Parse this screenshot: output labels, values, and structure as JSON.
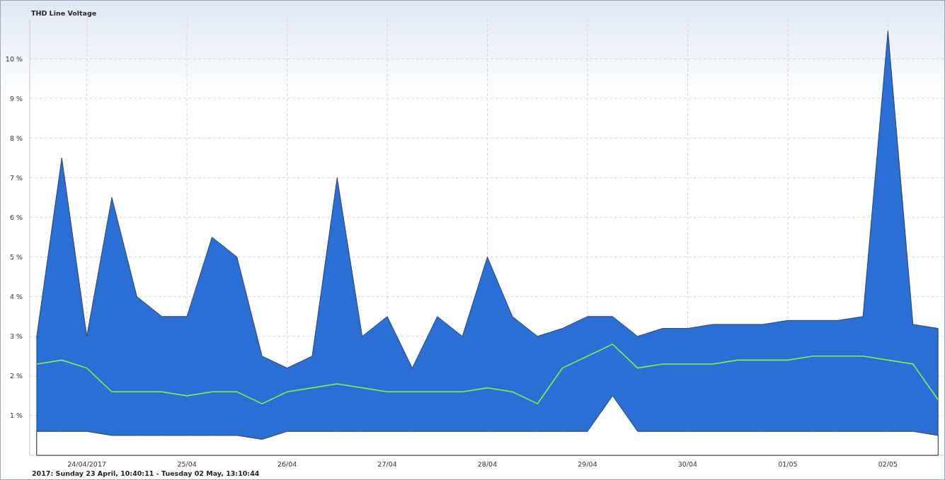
{
  "chart": {
    "title": "THD Line Voltage",
    "range_label": "2017: Sunday 23 April, 10:40:11 - Tuesday 02 May, 13:10:44",
    "chart_data": {
      "type": "area",
      "grid": true,
      "ylim": [
        0,
        11
      ],
      "yticks": [
        {
          "value": 1,
          "label": "1 %"
        },
        {
          "value": 2,
          "label": "2 %"
        },
        {
          "value": 3,
          "label": "3 %"
        },
        {
          "value": 4,
          "label": "4 %"
        },
        {
          "value": 5,
          "label": "5 %"
        },
        {
          "value": 6,
          "label": "6 %"
        },
        {
          "value": 7,
          "label": "7 %"
        },
        {
          "value": 8,
          "label": "8 %"
        },
        {
          "value": 9,
          "label": "9 %"
        },
        {
          "value": 10,
          "label": "10 %"
        }
      ],
      "categories": [
        null,
        null,
        "24/04/2017",
        null,
        null,
        null,
        "25/04",
        null,
        null,
        null,
        "26/04",
        null,
        null,
        null,
        "27/04",
        null,
        null,
        null,
        "28/04",
        null,
        null,
        null,
        "29/04",
        null,
        null,
        null,
        "30/04",
        null,
        null,
        null,
        "01/05",
        null,
        null,
        null,
        "02/05",
        null,
        null
      ],
      "series": [
        {
          "color": "#2a6fd6",
          "values": [
            3.0,
            7.5,
            3.0,
            6.5,
            4.0,
            3.5,
            3.5,
            5.5,
            5.0,
            2.5,
            2.2,
            2.5,
            7.0,
            3.0,
            3.5,
            2.2,
            3.5,
            3.0,
            5.0,
            3.5,
            3.0,
            3.2,
            3.5,
            3.5,
            3.0,
            3.2,
            3.2,
            3.3,
            3.3,
            3.3,
            3.4,
            3.4,
            3.4,
            3.5,
            10.7,
            3.3,
            3.2
          ]
        },
        {
          "color": "#ffffff",
          "values": [
            0.6,
            0.6,
            0.6,
            0.5,
            0.5,
            0.5,
            0.5,
            0.5,
            0.5,
            0.4,
            0.6,
            0.6,
            0.6,
            0.6,
            0.6,
            0.6,
            0.6,
            0.6,
            0.6,
            0.6,
            0.6,
            0.6,
            0.6,
            1.5,
            0.6,
            0.6,
            0.6,
            0.6,
            0.6,
            0.6,
            0.6,
            0.6,
            0.6,
            0.6,
            0.6,
            0.6,
            0.5
          ]
        },
        {
          "type": "line",
          "color": "#8cf040",
          "values": [
            2.3,
            2.4,
            2.2,
            1.6,
            1.6,
            1.6,
            1.5,
            1.6,
            1.6,
            1.3,
            1.6,
            1.7,
            1.8,
            1.7,
            1.6,
            1.6,
            1.6,
            1.6,
            1.7,
            1.6,
            1.3,
            2.2,
            2.5,
            2.8,
            2.2,
            2.3,
            2.3,
            2.3,
            2.4,
            2.4,
            2.4,
            2.5,
            2.5,
            2.5,
            2.4,
            2.3,
            1.4
          ]
        }
      ]
    }
  }
}
